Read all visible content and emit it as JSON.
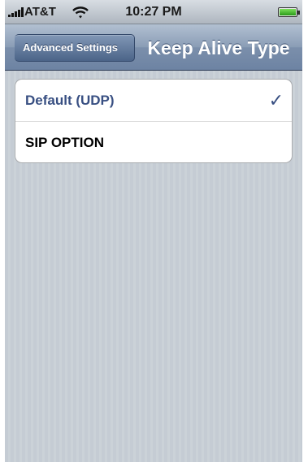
{
  "status_bar": {
    "carrier": "AT&T",
    "time": "10:27 PM",
    "icons": [
      "signal-bars-icon",
      "wifi-icon",
      "battery-icon"
    ]
  },
  "nav_bar": {
    "back_label": "Advanced Settings",
    "title": "Keep Alive Type"
  },
  "options": [
    {
      "label": "Default (UDP)",
      "selected": true
    },
    {
      "label": "SIP OPTION",
      "selected": false
    }
  ],
  "selection_mark": "✓",
  "colors": {
    "nav_bar": "#7b8fab",
    "selected_text": "#384f82",
    "background": "#c5ccd4"
  }
}
